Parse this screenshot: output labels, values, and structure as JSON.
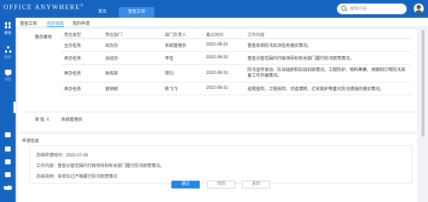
{
  "app": {
    "logo_text": "Office Anywhere",
    "logo_mark": "®",
    "nav": {
      "home": "首页",
      "active": "督查立项"
    }
  },
  "search": {
    "placeholder": "搜索内容"
  },
  "sidebar": {
    "items": [
      {
        "label": "菜单",
        "icon": "grid-icon"
      },
      {
        "label": "组织",
        "icon": "org-tree-icon"
      },
      {
        "label": "消息",
        "icon": "message-icon"
      }
    ],
    "bottom_icons": [
      "screen-icon",
      "document-icon",
      "download-icon",
      "shirt-icon",
      "more-icon"
    ]
  },
  "subtabs": [
    "督查立项",
    "待办审批",
    "我的申请"
  ],
  "subtab_active_index": 1,
  "detail": {
    "section_label": "督办事项",
    "columns": [
      "责任类型",
      "责任部门",
      "部门负责人",
      "截止时间",
      "工作内容"
    ],
    "rows": [
      {
        "type": "主办任务",
        "dept": "综合办",
        "head": "系统管理员",
        "deadline": "2022-08-31",
        "content": "督查各项防汛抗洪任务落实情况。"
      },
      {
        "type": "承办任务",
        "dept": "总经办",
        "head": "李佳",
        "deadline": "2022-08-31",
        "content": "督查分管范围内行政领导和有关部门履行防汛职责情况。"
      },
      {
        "type": "承办任务",
        "dept": "财务部",
        "head": "常归",
        "deadline": "2022-08-31",
        "content": "防汛宣传发动、队伍组织和实战训练情况，工程防护、物料筹集、预案制订等防汛准备工作开展情况。"
      },
      {
        "type": "承办任务",
        "dept": "营销部",
        "head": "陈飞飞",
        "deadline": "2022-08-31",
        "content": "巡堤查险、工程抢险、河道清障、迁安救护等重大防汛措施的落实情况。"
      }
    ],
    "reviewer_label": "审 批 人",
    "reviewer_value": "系统管理员"
  },
  "apply_info": {
    "title": "申请信息",
    "apply_time_label": "办结申请时间：",
    "apply_time": "2022-07-08",
    "work_content_label": "工作内容：",
    "work_content": "督查分管范围内行政领导和有关部门履行防汛职责情况。",
    "completion_label": "办结说明：",
    "completion_note": "各单位已严格履行防汛职责情况"
  },
  "buttons": {
    "approve": "通过",
    "reject": "驳回",
    "back": "返回"
  },
  "colors": {
    "brand": "#1565c0",
    "accent": "#1e88e5",
    "background": "#f0f2f5"
  }
}
